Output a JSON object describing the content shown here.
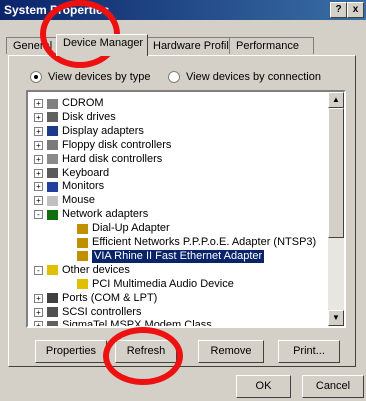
{
  "window": {
    "title": "System Properties",
    "help_label": "?",
    "close_label": "x"
  },
  "tabs": [
    {
      "label": "General"
    },
    {
      "label": "Device Manager"
    },
    {
      "label": "Hardware Profiles"
    },
    {
      "label": "Performance"
    }
  ],
  "view": {
    "by_type": "View devices by type",
    "by_connection": "View devices by connection"
  },
  "tree": [
    {
      "label": "CDROM",
      "icon": "cdrom-icon",
      "expander": "+"
    },
    {
      "label": "Disk drives",
      "icon": "disk-drive-icon",
      "expander": "+"
    },
    {
      "label": "Display adapters",
      "icon": "display-icon",
      "expander": "+"
    },
    {
      "label": "Floppy disk controllers",
      "icon": "floppy-icon",
      "expander": "+"
    },
    {
      "label": "Hard disk controllers",
      "icon": "hard-disk-icon",
      "expander": "+"
    },
    {
      "label": "Keyboard",
      "icon": "keyboard-icon",
      "expander": "+"
    },
    {
      "label": "Monitors",
      "icon": "monitor-icon",
      "expander": "+"
    },
    {
      "label": "Mouse",
      "icon": "mouse-icon",
      "expander": "+"
    },
    {
      "label": "Network adapters",
      "icon": "network-icon",
      "expander": "-"
    },
    {
      "label": "Dial-Up Adapter",
      "icon": "network-card-icon",
      "expander": ""
    },
    {
      "label": "Efficient Networks P.P.P.o.E. Adapter (NTSP3)",
      "icon": "network-card-icon",
      "expander": ""
    },
    {
      "label": "VIA Rhine II Fast Ethernet Adapter",
      "icon": "network-card-icon",
      "expander": ""
    },
    {
      "label": "Other devices",
      "icon": "question-icon",
      "expander": "-"
    },
    {
      "label": "PCI Multimedia Audio Device",
      "icon": "question-icon",
      "expander": ""
    },
    {
      "label": "Ports (COM & LPT)",
      "icon": "port-icon",
      "expander": "+"
    },
    {
      "label": "SCSI controllers",
      "icon": "scsi-icon",
      "expander": "+"
    },
    {
      "label": "SigmaTel MSPX Modem Class",
      "icon": "modem-icon",
      "expander": "+"
    }
  ],
  "buttons": {
    "properties": "Properties",
    "refresh": "Refresh",
    "remove": "Remove",
    "print": "Print...",
    "ok": "OK",
    "cancel": "Cancel"
  },
  "colors": {
    "highlight_circle": "#ee1111",
    "selection": "#0a246a",
    "titlebar": "#0a246a"
  }
}
